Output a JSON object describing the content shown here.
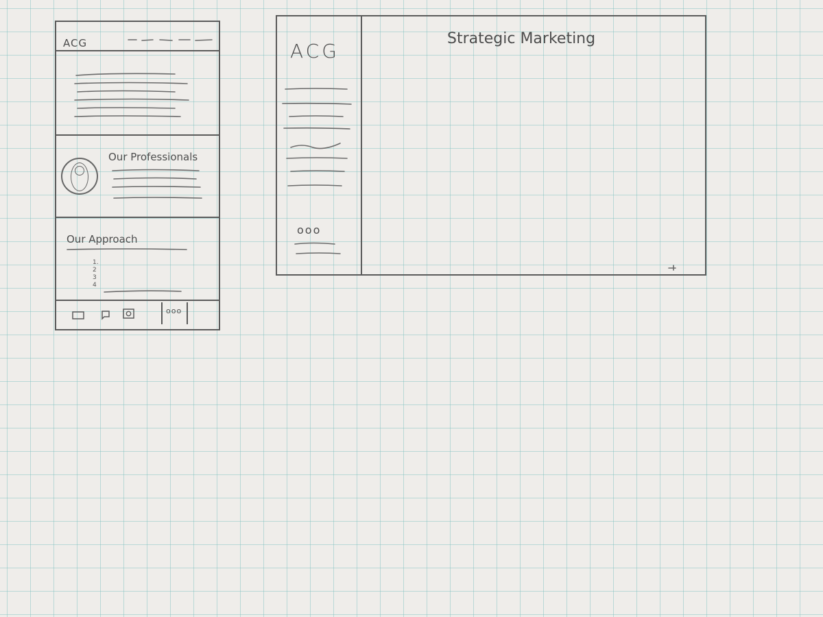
{
  "mobile": {
    "logo": "ACG",
    "professionals_heading": "Our Professionals",
    "approach_heading": "Our Approach",
    "approach_list": [
      "1.",
      "2",
      "3",
      "4"
    ],
    "footer_icons": [
      "monitor-icon",
      "chat-icon",
      "camera-icon"
    ],
    "footer_more": "ooo"
  },
  "desktop": {
    "logo": "ACG",
    "page_title": "Strategic Marketing",
    "sidebar_more": "ooo"
  }
}
